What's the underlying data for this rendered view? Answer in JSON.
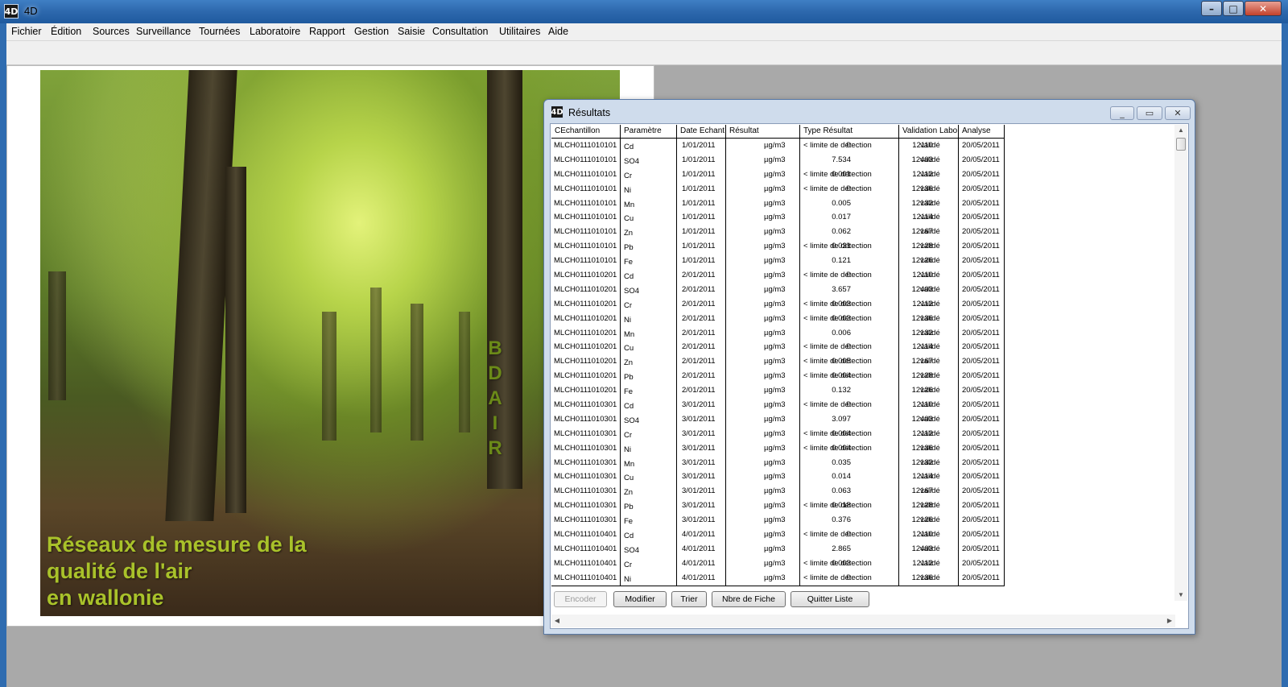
{
  "window": {
    "title": "4D",
    "icon": "4d-logo-icon"
  },
  "menu": [
    "Fichier",
    "Édition",
    "Sources",
    "Surveillance",
    "Tournées",
    "Laboratoire",
    "Rapport",
    "Gestion",
    "Saisie",
    "Consultation",
    "Utilitaires",
    "Aide"
  ],
  "splash": {
    "vertical_text": [
      "B",
      "D",
      "A",
      "I",
      "R"
    ],
    "caption": [
      "Réseaux de mesure de la",
      "qualité de l'air",
      "en wallonie"
    ]
  },
  "results": {
    "title": "Résultats",
    "columns": [
      "CEchantillon",
      "Paramètre",
      "Date Echant",
      "Résultat",
      "Type Résultat",
      "Validation Labo",
      "Analyse"
    ],
    "rows": [
      [
        "MLCH0111010101",
        "Cd",
        "12110",
        "1/01/2011",
        "0",
        "µg/m3",
        "< limite de détection",
        "validé",
        "20/05/2011"
      ],
      [
        "MLCH0111010101",
        "SO4",
        "12403",
        "1/01/2011",
        "7.534",
        "µg/m3",
        "",
        "validé",
        "20/05/2011"
      ],
      [
        "MLCH0111010101",
        "Cr",
        "12112",
        "1/01/2011",
        "0.001",
        "µg/m3",
        "< limite de détection",
        "validé",
        "20/05/2011"
      ],
      [
        "MLCH0111010101",
        "Ni",
        "12136",
        "1/01/2011",
        "0",
        "µg/m3",
        "< limite de détection",
        "validé",
        "20/05/2011"
      ],
      [
        "MLCH0111010101",
        "Mn",
        "12132",
        "1/01/2011",
        "0.005",
        "µg/m3",
        "",
        "validé",
        "20/05/2011"
      ],
      [
        "MLCH0111010101",
        "Cu",
        "12114",
        "1/01/2011",
        "0.017",
        "µg/m3",
        "",
        "validé",
        "20/05/2011"
      ],
      [
        "MLCH0111010101",
        "Zn",
        "12167",
        "1/01/2011",
        "0.062",
        "µg/m3",
        "",
        "validé",
        "20/05/2011"
      ],
      [
        "MLCH0111010101",
        "Pb",
        "12128",
        "1/01/2011",
        "0.021",
        "µg/m3",
        "< limite de détection",
        "validé",
        "20/05/2011"
      ],
      [
        "MLCH0111010101",
        "Fe",
        "12126",
        "1/01/2011",
        "0.121",
        "µg/m3",
        "",
        "validé",
        "20/05/2011"
      ],
      [
        "MLCH0111010201",
        "Cd",
        "12110",
        "2/01/2011",
        "0",
        "µg/m3",
        "< limite de détection",
        "validé",
        "20/05/2011"
      ],
      [
        "MLCH0111010201",
        "SO4",
        "12403",
        "2/01/2011",
        "3.657",
        "µg/m3",
        "",
        "validé",
        "20/05/2011"
      ],
      [
        "MLCH0111010201",
        "Cr",
        "12112",
        "2/01/2011",
        "0.003",
        "µg/m3",
        "< limite de détection",
        "validé",
        "20/05/2011"
      ],
      [
        "MLCH0111010201",
        "Ni",
        "12136",
        "2/01/2011",
        "0.003",
        "µg/m3",
        "< limite de détection",
        "validé",
        "20/05/2011"
      ],
      [
        "MLCH0111010201",
        "Mn",
        "12132",
        "2/01/2011",
        "0.006",
        "µg/m3",
        "",
        "validé",
        "20/05/2011"
      ],
      [
        "MLCH0111010201",
        "Cu",
        "12114",
        "2/01/2011",
        "0",
        "µg/m3",
        "< limite de détection",
        "validé",
        "20/05/2011"
      ],
      [
        "MLCH0111010201",
        "Zn",
        "12167",
        "2/01/2011",
        "0.005",
        "µg/m3",
        "< limite de détection",
        "validé",
        "20/05/2011"
      ],
      [
        "MLCH0111010201",
        "Pb",
        "12128",
        "2/01/2011",
        "0.004",
        "µg/m3",
        "< limite de détection",
        "validé",
        "20/05/2011"
      ],
      [
        "MLCH0111010201",
        "Fe",
        "12126",
        "2/01/2011",
        "0.132",
        "µg/m3",
        "",
        "validé",
        "20/05/2011"
      ],
      [
        "MLCH0111010301",
        "Cd",
        "12110",
        "3/01/2011",
        "0",
        "µg/m3",
        "< limite de détection",
        "validé",
        "20/05/2011"
      ],
      [
        "MLCH0111010301",
        "SO4",
        "12403",
        "3/01/2011",
        "3.097",
        "µg/m3",
        "",
        "validé",
        "20/05/2011"
      ],
      [
        "MLCH0111010301",
        "Cr",
        "12112",
        "3/01/2011",
        "0.004",
        "µg/m3",
        "< limite de détection",
        "validé",
        "20/05/2011"
      ],
      [
        "MLCH0111010301",
        "Ni",
        "12136",
        "3/01/2011",
        "0.004",
        "µg/m3",
        "< limite de détection",
        "validé",
        "20/05/2011"
      ],
      [
        "MLCH0111010301",
        "Mn",
        "12132",
        "3/01/2011",
        "0.035",
        "µg/m3",
        "",
        "validé",
        "20/05/2011"
      ],
      [
        "MLCH0111010301",
        "Cu",
        "12114",
        "3/01/2011",
        "0.014",
        "µg/m3",
        "",
        "validé",
        "20/05/2011"
      ],
      [
        "MLCH0111010301",
        "Zn",
        "12167",
        "3/01/2011",
        "0.063",
        "µg/m3",
        "",
        "validé",
        "20/05/2011"
      ],
      [
        "MLCH0111010301",
        "Pb",
        "12128",
        "3/01/2011",
        "0.018",
        "µg/m3",
        "< limite de détection",
        "validé",
        "20/05/2011"
      ],
      [
        "MLCH0111010301",
        "Fe",
        "12126",
        "3/01/2011",
        "0.376",
        "µg/m3",
        "",
        "validé",
        "20/05/2011"
      ],
      [
        "MLCH0111010401",
        "Cd",
        "12110",
        "4/01/2011",
        "0",
        "µg/m3",
        "< limite de détection",
        "validé",
        "20/05/2011"
      ],
      [
        "MLCH0111010401",
        "SO4",
        "12403",
        "4/01/2011",
        "2.865",
        "µg/m3",
        "",
        "validé",
        "20/05/2011"
      ],
      [
        "MLCH0111010401",
        "Cr",
        "12112",
        "4/01/2011",
        "0.003",
        "µg/m3",
        "< limite de détection",
        "validé",
        "20/05/2011"
      ],
      [
        "MLCH0111010401",
        "Ni",
        "12136",
        "4/01/2011",
        "0",
        "µg/m3",
        "< limite de détection",
        "validé",
        "20/05/2011"
      ]
    ],
    "buttons": {
      "encoder": "Encoder",
      "modifier": "Modifier",
      "trier": "Trier",
      "nbre_fiche": "Nbre de Fiche",
      "quitter": "Quitter Liste"
    }
  }
}
